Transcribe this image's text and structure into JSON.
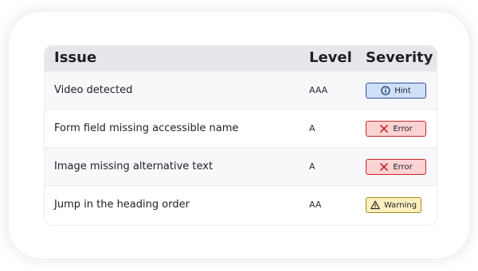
{
  "table": {
    "headers": {
      "issue": "Issue",
      "level": "Level",
      "severity": "Severity"
    },
    "rows": [
      {
        "issue": "Video detected",
        "level": "AAA",
        "severity": "Hint",
        "severity_type": "hint",
        "icon": "info-icon"
      },
      {
        "issue": "Form field missing accessible name",
        "level": "A",
        "severity": "Error",
        "severity_type": "error",
        "icon": "close-x-icon"
      },
      {
        "issue": "Image missing alternative text",
        "level": "A",
        "severity": "Error",
        "severity_type": "error",
        "icon": "close-x-icon"
      },
      {
        "issue": "Jump in the heading order",
        "level": "AA",
        "severity": "Warning",
        "severity_type": "warning",
        "icon": "warning-triangle-icon"
      }
    ]
  },
  "colors": {
    "header_bg": "#e7e6ec",
    "hint_bg": "#cfe0fb",
    "hint_border": "#2d4f96",
    "hint_icon": "#1d3470",
    "error_bg": "#fbd3d3",
    "error_border": "#c8262c",
    "error_icon": "#c8262c",
    "warning_bg": "#fbefbd",
    "warning_border": "#a78a1f",
    "warning_icon": "#222222"
  }
}
